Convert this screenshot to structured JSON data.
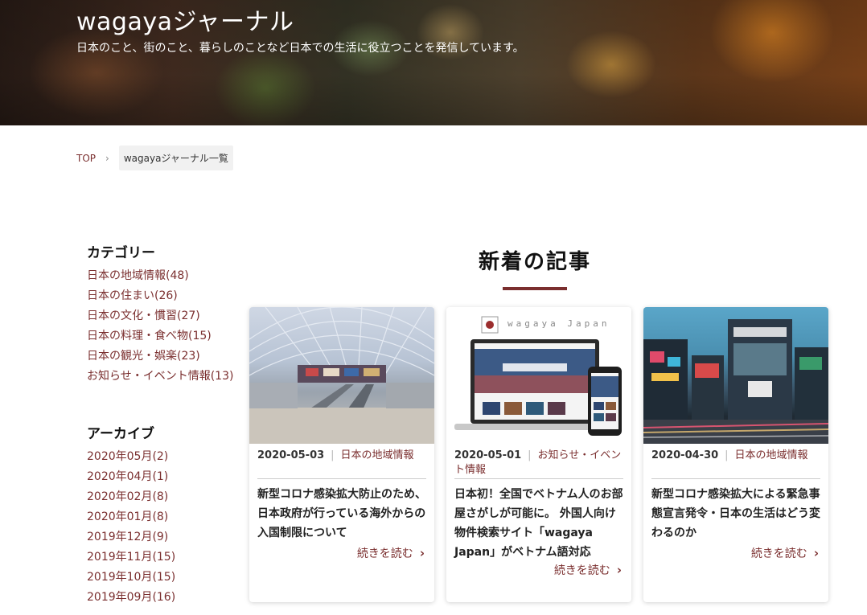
{
  "hero": {
    "title": "wagayaジャーナル",
    "subtitle": "日本のこと、街のこと、暮らしのことなど日本での生活に役立つことを発信しています。"
  },
  "breadcrumb": {
    "top": "TOP",
    "separator": "›",
    "current": "wagayaジャーナル一覧"
  },
  "sidebar": {
    "categories_heading": "カテゴリー",
    "categories": [
      "日本の地域情報(48)",
      "日本の住まい(26)",
      "日本の文化・慣習(27)",
      "日本の料理・食べ物(15)",
      "日本の観光・娯楽(23)",
      "お知らせ・イベント情報(13)"
    ],
    "archive_heading": "アーカイブ",
    "archives": [
      "2020年05月(2)",
      "2020年04月(1)",
      "2020年02月(8)",
      "2020年01月(8)",
      "2019年12月(9)",
      "2019年11月(15)",
      "2019年10月(15)",
      "2019年09月(16)"
    ]
  },
  "main": {
    "title": "新着の記事",
    "read_more": "続きを読む",
    "cards": [
      {
        "date": "2020-05-03",
        "category": "日本の地域情報",
        "title": "新型コロナ感染拡大防止のため、日本政府が行っている海外からの入国制限について"
      },
      {
        "date": "2020-05-01",
        "category": "お知らせ・イベント情報",
        "title": "日本初！全国でベトナム人のお部屋さがしが可能に。 外国人向け物件検索サイト「wagaya Japan」がベトナム語対応",
        "image_logo": "wagaya Japan"
      },
      {
        "date": "2020-04-30",
        "category": "日本の地域情報",
        "title": "新型コロナ感染拡大による緊急事態宣言発令・日本の生活はどう変わるのか"
      }
    ]
  },
  "colors": {
    "accent": "#7a2e2e",
    "text": "#222222"
  }
}
